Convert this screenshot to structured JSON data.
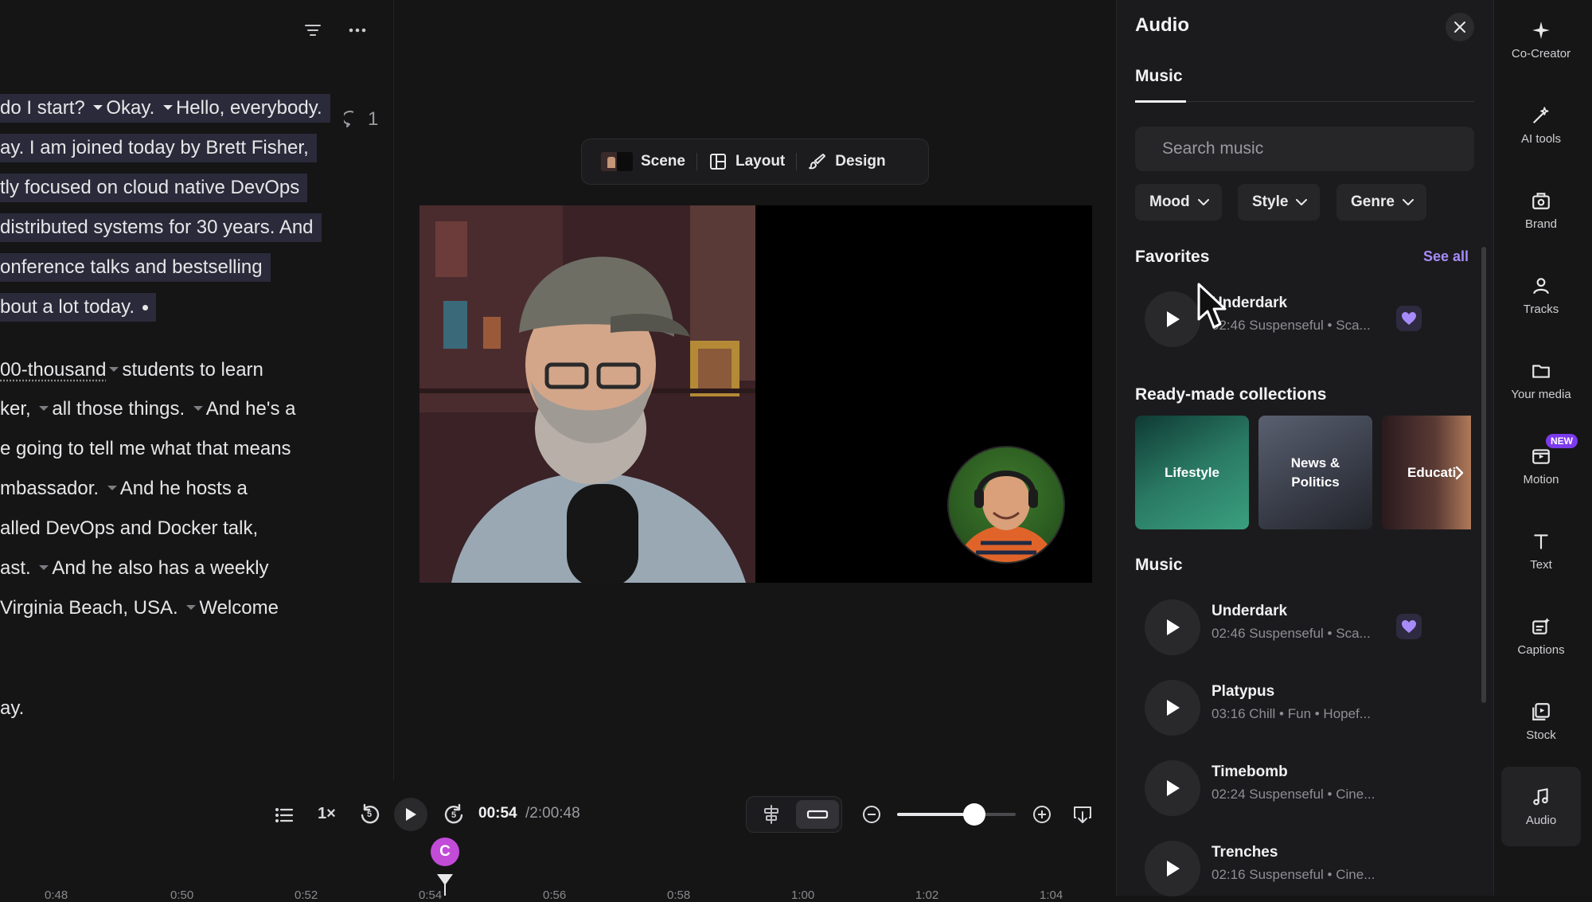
{
  "transcript": {
    "lines": [
      {
        "segments": [
          {
            "t": "do I start? "
          },
          {
            "tri": true
          },
          {
            "t": "Okay. "
          },
          {
            "tri": true
          },
          {
            "t": "Hello, everybody."
          }
        ],
        "highlight": true
      },
      {
        "segments": [
          {
            "t": "ay. I am joined today by Brett Fisher,"
          }
        ],
        "highlight": true
      },
      {
        "segments": [
          {
            "t": "tly focused on cloud native DevOps"
          }
        ],
        "highlight": true
      },
      {
        "segments": [
          {
            "t": "distributed systems for 30 years. And"
          }
        ],
        "highlight": true
      },
      {
        "segments": [
          {
            "t": "onference talks and bestselling"
          }
        ],
        "highlight": true
      },
      {
        "segments": [
          {
            "t": "bout a lot today."
          },
          {
            "dot": true
          }
        ],
        "highlight": true
      },
      {
        "segments": [
          {
            "t": "00-thousand",
            "u": true
          },
          {
            "tri": true
          },
          {
            "t": "students to learn"
          }
        ],
        "highlight": false
      },
      {
        "segments": [
          {
            "t": "ker, "
          },
          {
            "tri": true
          },
          {
            "t": "all those things. "
          },
          {
            "tri": true
          },
          {
            "t": "And he's a"
          }
        ],
        "highlight": false
      },
      {
        "segments": [
          {
            "t": "e going to tell me what that means"
          }
        ],
        "highlight": false
      },
      {
        "segments": [
          {
            "t": "mbassador. "
          },
          {
            "tri": true
          },
          {
            "t": "And he hosts a"
          }
        ],
        "highlight": false
      },
      {
        "segments": [
          {
            "t": "alled DevOps and Docker talk,"
          }
        ],
        "highlight": false
      },
      {
        "segments": [
          {
            "t": "ast. "
          },
          {
            "tri": true
          },
          {
            "t": "And he also has a weekly"
          }
        ],
        "highlight": false
      },
      {
        "segments": [
          {
            "t": " Virginia Beach, USA. "
          },
          {
            "tri": true
          },
          {
            "t": "Welcome"
          }
        ],
        "highlight": false
      },
      {
        "segments": [
          {
            "t": "ay."
          }
        ],
        "highlight": false
      }
    ],
    "comment_count": "1"
  },
  "toolbar": {
    "scene_label": "Scene",
    "layout_label": "Layout",
    "design_label": "Design"
  },
  "player": {
    "speed": "1×",
    "rewind_seconds": "5",
    "forward_seconds": "5",
    "time_current": "00:54",
    "time_total": "/2:00:48",
    "zoom_level": 0.65
  },
  "timeline": {
    "playhead_label": "C",
    "ticks": [
      "0:48",
      "0:50",
      "0:52",
      "0:54",
      "0:56",
      "0:58",
      "1:00",
      "1:02",
      "1:04"
    ]
  },
  "audio": {
    "title": "Audio",
    "tab": "Music",
    "search_placeholder": "Search music",
    "filters": [
      "Mood",
      "Style",
      "Genre"
    ],
    "favorites_heading": "Favorites",
    "see_all": "See all",
    "favorites": [
      {
        "title": "Underdark",
        "meta": "02:46 Suspenseful • Sca...",
        "liked": true
      }
    ],
    "collections_heading": "Ready-made collections",
    "collections": [
      "Lifestyle",
      "News & Politics",
      "Educati"
    ],
    "music_heading": "Music",
    "tracks": [
      {
        "title": "Underdark",
        "meta": "02:46 Suspenseful • Sca...",
        "liked": true
      },
      {
        "title": "Platypus",
        "meta": "03:16 Chill • Fun • Hopef...",
        "liked": false
      },
      {
        "title": "Timebomb",
        "meta": "02:24 Suspenseful • Cine...",
        "liked": false
      },
      {
        "title": "Trenches",
        "meta": "02:16 Suspenseful • Cine...",
        "liked": false
      }
    ]
  },
  "rail": {
    "items": [
      {
        "label": "Co-Creator",
        "icon": "sparkle-icon"
      },
      {
        "label": "AI tools",
        "icon": "magic-wand-icon"
      },
      {
        "label": "Brand",
        "icon": "brand-kit-icon"
      },
      {
        "label": "Tracks",
        "icon": "person-icon"
      },
      {
        "label": "Your media",
        "icon": "folder-icon"
      },
      {
        "label": "Motion",
        "icon": "motion-icon",
        "badge": "NEW"
      },
      {
        "label": "Text",
        "icon": "text-icon"
      },
      {
        "label": "Captions",
        "icon": "captions-icon"
      },
      {
        "label": "Stock",
        "icon": "stock-icon"
      },
      {
        "label": "Audio",
        "icon": "music-note-icon",
        "active": true
      }
    ]
  },
  "colors": {
    "accent": "#a78bfa",
    "heart": "#a78bfa",
    "playhead": "#c24bd8",
    "new_badge": "#7c3aed",
    "highlight": "#2a2a3a"
  }
}
